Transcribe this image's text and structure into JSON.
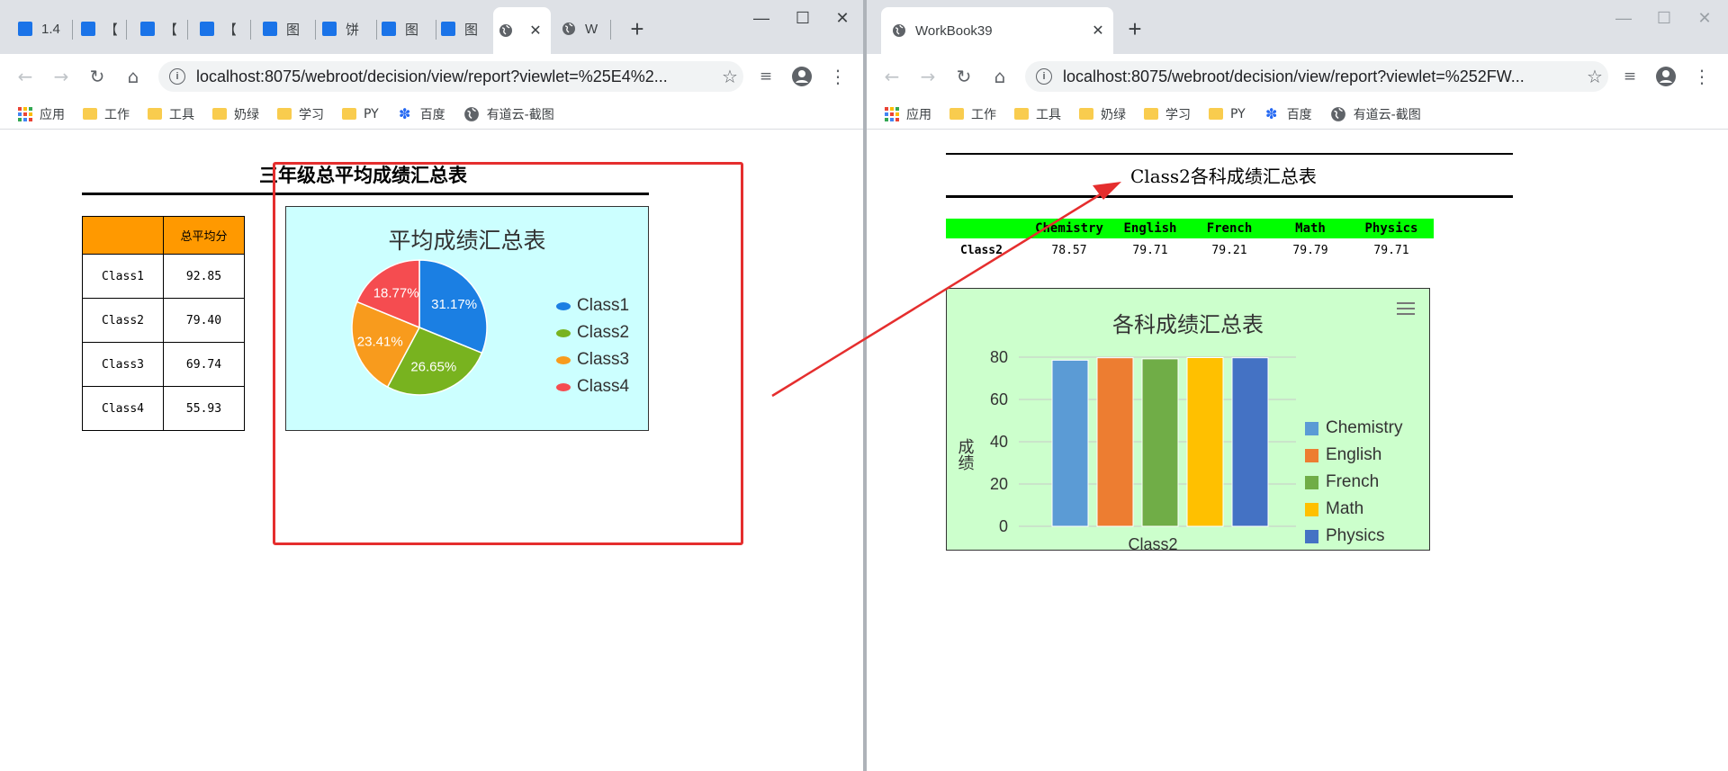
{
  "left_window": {
    "tabs": [
      {
        "label": "1.4"
      },
      {
        "label": "【"
      },
      {
        "label": "【"
      },
      {
        "label": "【"
      },
      {
        "label": "图"
      },
      {
        "label": "饼"
      },
      {
        "label": "图"
      },
      {
        "label": "图"
      },
      {
        "label": ""
      },
      {
        "label": "W"
      }
    ],
    "url": "localhost:8075/webroot/decision/view/report?viewlet=%25E4%2...",
    "report": {
      "title": "三年级总平均成绩汇总表",
      "table_header": [
        "",
        "总平均分"
      ],
      "rows": [
        {
          "class": "Class1",
          "avg": "92.85"
        },
        {
          "class": "Class2",
          "avg": "79.40"
        },
        {
          "class": "Class3",
          "avg": "69.74"
        },
        {
          "class": "Class4",
          "avg": "55.93"
        }
      ],
      "chart_title": "平均成绩汇总表"
    }
  },
  "right_window": {
    "tab_title": "WorkBook39",
    "url": "localhost:8075/webroot/decision/view/report?viewlet=%252FW...",
    "report": {
      "title": "Class2各科成绩汇总表",
      "header": [
        "Chemistry",
        "English",
        "French",
        "Math",
        "Physics"
      ],
      "row_label": "Class2",
      "values": [
        "78.57",
        "79.71",
        "79.21",
        "79.79",
        "79.71"
      ],
      "chart_title": "各科成绩汇总表"
    }
  },
  "bookmarks": [
    "应用",
    "工作",
    "工具",
    "奶绿",
    "学习",
    "PY",
    "百度",
    "有道云-截图"
  ],
  "chart_data": [
    {
      "type": "pie",
      "title": "平均成绩汇总表",
      "categories": [
        "Class1",
        "Class2",
        "Class3",
        "Class4"
      ],
      "values": [
        31.17,
        26.65,
        23.41,
        18.77
      ],
      "labels": [
        "31.17%",
        "26.65%",
        "23.41%",
        "18.77%"
      ],
      "colors": [
        "#1b7fe3",
        "#78b31f",
        "#f89b1d",
        "#f54c50"
      ],
      "legend": "right"
    },
    {
      "type": "bar",
      "title": "各科成绩汇总表",
      "categories": [
        "Class2"
      ],
      "series": [
        {
          "name": "Chemistry",
          "values": [
            78.57
          ],
          "color": "#5b9bd5"
        },
        {
          "name": "English",
          "values": [
            79.71
          ],
          "color": "#ed7d31"
        },
        {
          "name": "French",
          "values": [
            79.21
          ],
          "color": "#70ad47"
        },
        {
          "name": "Math",
          "values": [
            79.79
          ],
          "color": "#ffc000"
        },
        {
          "name": "Physics",
          "values": [
            79.71
          ],
          "color": "#4472c4"
        }
      ],
      "ylabel": "成绩",
      "ylim": [
        0,
        80
      ],
      "yticks": [
        0,
        20,
        40,
        60,
        80
      ],
      "grid": true,
      "legend": "right"
    }
  ],
  "colors": {
    "table_header": "#ff9900",
    "pie_bg": "#ccffff",
    "bar_bg": "#ccffcc",
    "subject_header": "#00ff00",
    "highlight": "#e52e2e"
  }
}
